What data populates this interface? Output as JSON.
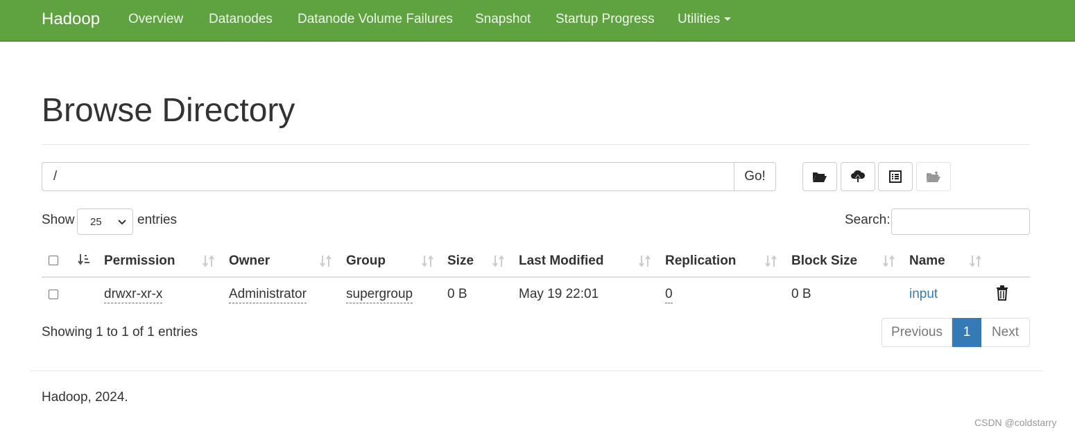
{
  "navbar": {
    "brand": "Hadoop",
    "items": [
      "Overview",
      "Datanodes",
      "Datanode Volume Failures",
      "Snapshot",
      "Startup Progress",
      "Utilities"
    ],
    "color": "#5fa341"
  },
  "page": {
    "title": "Browse Directory"
  },
  "path_bar": {
    "value": "/",
    "go_label": "Go!"
  },
  "toolbar": {
    "icons": [
      "folder-open-icon",
      "cloud-upload-icon",
      "list-alt-icon",
      "folder-move-icon"
    ]
  },
  "length_menu": {
    "show_label": "Show",
    "selected": "25",
    "entries_label": "entries"
  },
  "search": {
    "label": "Search:",
    "value": ""
  },
  "table": {
    "columns": [
      "Permission",
      "Owner",
      "Group",
      "Size",
      "Last Modified",
      "Replication",
      "Block Size",
      "Name"
    ],
    "rows": [
      {
        "permission": "drwxr-xr-x",
        "owner": "Administrator",
        "group": "supergroup",
        "size": "0 B",
        "last_modified": "May 19 22:01",
        "replication": "0",
        "block_size": "0 B",
        "name": "input"
      }
    ]
  },
  "info": "Showing 1 to 1 of 1 entries",
  "pagination": {
    "previous": "Previous",
    "current": "1",
    "next": "Next"
  },
  "footer": {
    "text": "Hadoop, 2024."
  },
  "watermark": "CSDN @coldstarry"
}
